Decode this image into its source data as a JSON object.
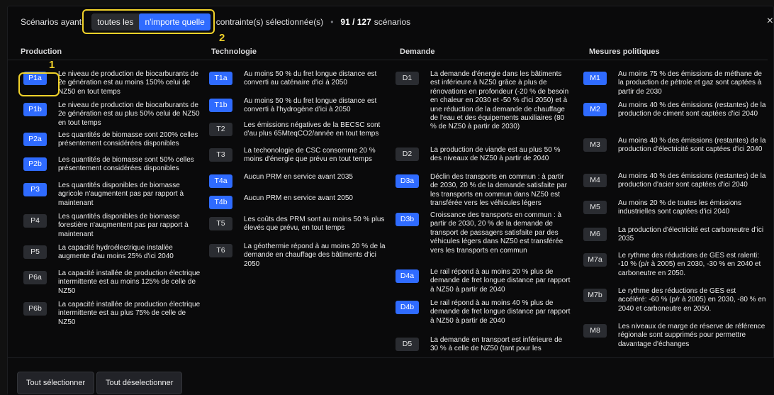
{
  "header": {
    "prefix": "Scénarios ayant",
    "toggle_all": "toutes les",
    "toggle_any": "n'importe quelle",
    "suffix": "contrainte(s) sélectionnée(s)",
    "separator": "•",
    "count": "91 / 127",
    "count_suffix": "scénarios",
    "close_icon": "×"
  },
  "annotations": {
    "step1": "1",
    "step2": "2",
    "highlight_color": "#f1d22a"
  },
  "columns": {
    "production": "Production",
    "technologie": "Technologie",
    "demande": "Demande",
    "mesures": "Mesures politiques"
  },
  "production": [
    {
      "code": "P1a",
      "selected": true,
      "text": "Le niveau de production de biocarburants de 2e génération est au moins 150% celui de NZ50 en tout temps"
    },
    {
      "code": "P1b",
      "selected": true,
      "text": "Le niveau de production de biocarburants de 2e génération est au plus 50% celui de NZ50 en tout temps"
    },
    {
      "code": "P2a",
      "selected": true,
      "text": "Les quantités de biomasse sont 200% celles présentement considérées disponibles"
    },
    {
      "code": "P2b",
      "selected": true,
      "text": "Les quantités de biomasse sont 50% celles présentement considérées disponibles"
    },
    {
      "code": "P3",
      "selected": true,
      "text": "Les quantités disponibles de biomasse agricole n'augmentent pas par rapport à maintenant"
    },
    {
      "code": "P4",
      "selected": false,
      "text": "Les quantités disponibles de biomasse forestière n'augmentent pas par rapport à maintenant"
    },
    {
      "code": "P5",
      "selected": false,
      "text": "La capacité hydroélectrique installée augmente d'au moins 25% d'ici 2040"
    },
    {
      "code": "P6a",
      "selected": false,
      "text": "La capacité installée de production électrique intermittente est au moins 125% de celle de NZ50"
    },
    {
      "code": "P6b",
      "selected": false,
      "text": "La capacité installée de production électrique intermittente est au plus 75% de celle de NZ50"
    }
  ],
  "technologie": [
    {
      "code": "T1a",
      "selected": true,
      "text": "Au moins 50 % du fret longue distance est converti au caténaire d'ici à 2050"
    },
    {
      "code": "T1b",
      "selected": true,
      "text": "Au moins 50 % du fret longue distance est converti à l'hydrogène d'ici à 2050"
    },
    {
      "code": "T2",
      "selected": false,
      "text": "Les émissions négatives de la BECSC sont d'au plus 65MteqCO2/année en tout temps"
    },
    {
      "code": "T3",
      "selected": false,
      "text": "La techonologie de CSC consomme 20 % moins d'énergie que prévu en tout temps"
    },
    {
      "code": "T4a",
      "selected": true,
      "text": "Aucun PRM en service avant 2035"
    },
    {
      "code": "T4b",
      "selected": true,
      "text": "Aucun PRM en service avant 2050"
    },
    {
      "code": "T5",
      "selected": false,
      "text": "Les coûts des PRM sont au moins 50 % plus élevés que prévu, en tout temps"
    },
    {
      "code": "T6",
      "selected": false,
      "text": "La géothermie répond à au moins 20 % de la demande en chauffage des bâtiments d'ici 2050"
    }
  ],
  "demande": [
    {
      "code": "D1",
      "selected": false,
      "text": "La demande d'énergie dans les bâtiments est inférieure à NZ50 grâce à plus de rénovations en profondeur (-20 % de besoin en chaleur en 2030 et -50 % d'ici 2050) et à une réduction de la demande de chauffage de l'eau et des équipements auxiliaires (80 % de NZ50 à partir de 2030)"
    },
    {
      "code": "D2",
      "selected": false,
      "text": "La production de viande est au plus 50 % des niveaux de NZ50 à partir de 2040"
    },
    {
      "code": "D3a",
      "selected": true,
      "text": "Déclin des transports en commun : à partir de 2030, 20 % de la demande satisfaite par les transports en commun dans NZ50 est transférée vers les véhicules légers"
    },
    {
      "code": "D3b",
      "selected": true,
      "text": "Croissance des transports en commun : à partir de 2030, 20 % de la demande de transport de passagers satisfaite par des véhicules légers dans NZ50 est transférée vers les transports en commun"
    },
    {
      "code": "D4a",
      "selected": true,
      "text": "Le rail répond à au moins 20 % plus de demande de fret longue distance par rapport à NZ50 à partir de 2040"
    },
    {
      "code": "D4b",
      "selected": true,
      "text": "Le rail répond à au moins 40 % plus de demande de fret longue distance par rapport à NZ50 à partir de 2040"
    },
    {
      "code": "D5",
      "selected": false,
      "text": "La demande en transport est inférieure de 30 % à celle de NZ50 (tant pour les"
    }
  ],
  "mesures": [
    {
      "code": "M1",
      "selected": true,
      "text": "Au moins 75 % des émissions de méthane de la production de pétrole et gaz sont captées à partir de 2030"
    },
    {
      "code": "M2",
      "selected": true,
      "text": "Au moins 40 % des émissions (restantes) de la production de ciment sont captées d'ici 2040"
    },
    {
      "code": "M3",
      "selected": false,
      "text": "Au moins 40 % des émissions (restantes) de la production d'électricité sont captées d'ici 2040"
    },
    {
      "code": "M4",
      "selected": false,
      "text": "Au moins 40 % des émissions (restantes) de la production d'acier sont captées d'ici 2040"
    },
    {
      "code": "M5",
      "selected": false,
      "text": "Au moins 20 % de toutes les émissions industrielles sont captées d'ici 2040"
    },
    {
      "code": "M6",
      "selected": false,
      "text": "La production d'électricité est carboneutre d'ici 2035"
    },
    {
      "code": "M7a",
      "selected": false,
      "text": "Le rythme des réductions de GES est ralenti: -10 % (p/r à 2005) en 2030, -30 % en 2040 et carboneutre en 2050."
    },
    {
      "code": "M7b",
      "selected": false,
      "text": "Le rythme des réductions de GES est accéléré: -60 % (p/r à 2005) en 2030, -80 % en 2040 et carboneutre en 2050."
    },
    {
      "code": "M8",
      "selected": false,
      "text": "Les niveaux de marge de réserve de référence régionale sont supprimés pour permettre davantage d'échanges"
    }
  ],
  "footer": {
    "select_all": "Tout sélectionner",
    "deselect_all": "Tout déselectionner"
  }
}
